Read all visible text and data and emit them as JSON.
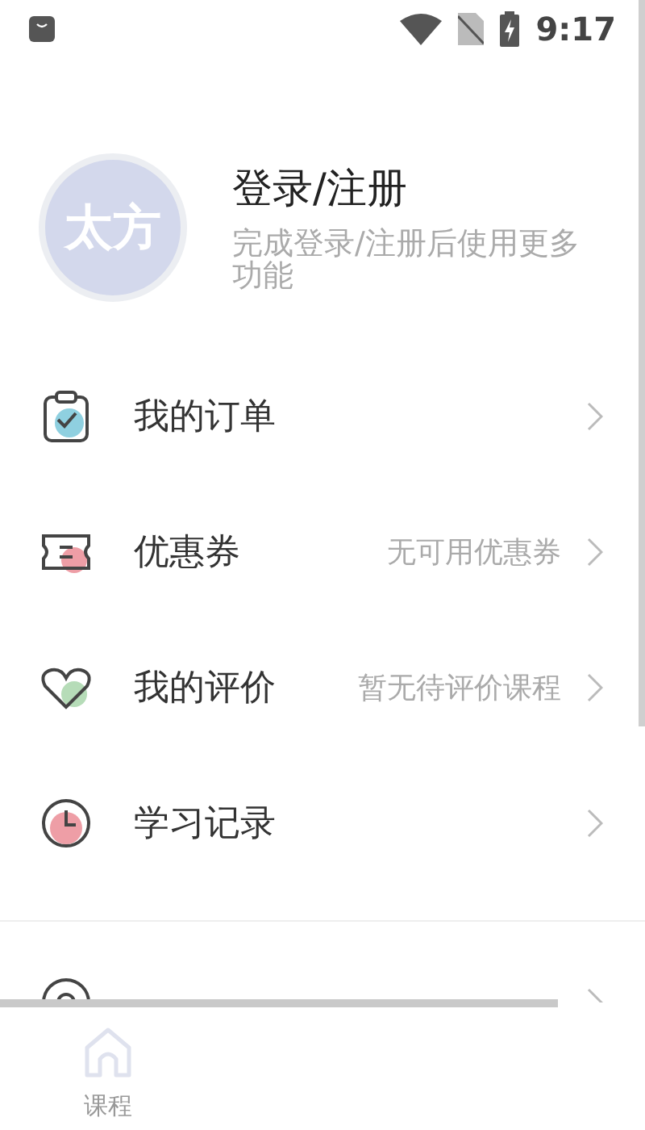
{
  "status_bar": {
    "time": "9:17"
  },
  "profile": {
    "avatar_text": "太方",
    "title": "登录/注册",
    "subtitle": "完成登录/注册后使用更多功能"
  },
  "menu": [
    {
      "kind": "order",
      "label": "我的订单"
    },
    {
      "kind": "coupon",
      "label": "优惠券",
      "note": "无可用优惠券"
    },
    {
      "kind": "review",
      "label": "我的评价",
      "note": "暂无待评价课程"
    },
    {
      "kind": "history",
      "label": "学习记录"
    },
    {
      "kind": "help"
    }
  ],
  "bottom_nav": [
    {
      "label": "课程",
      "selected": false
    }
  ]
}
